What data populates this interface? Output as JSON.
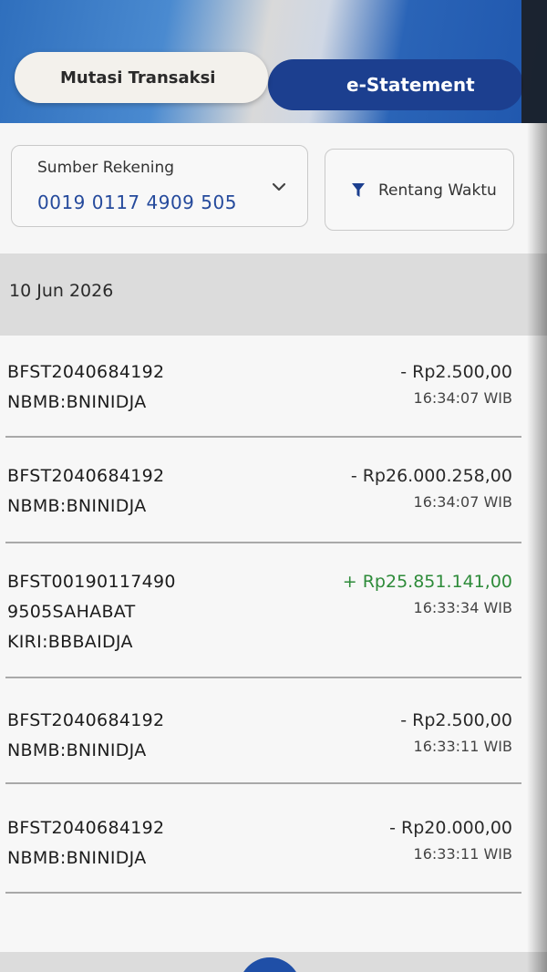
{
  "tabs": {
    "mutasi_label": "Mutasi Transaksi",
    "statement_label": "e-Statement"
  },
  "filters": {
    "account_label": "Sumber Rekening",
    "account_number": "0019 0117 4909 505",
    "range_label": "Rentang Waktu"
  },
  "date_header": "10 Jun 2026",
  "transactions": [
    {
      "desc_line1": "BFST2040684192",
      "desc_line2": "NBMB:BNINIDJA",
      "desc_line3": "",
      "amount": "- Rp2.500,00",
      "time": "16:34:07 WIB",
      "type": "debit"
    },
    {
      "desc_line1": "BFST2040684192",
      "desc_line2": "NBMB:BNINIDJA",
      "desc_line3": "",
      "amount": "- Rp26.000.258,00",
      "time": "16:34:07 WIB",
      "type": "debit"
    },
    {
      "desc_line1": "BFST00190117490",
      "desc_line2": "9505SAHABAT",
      "desc_line3": "KIRI:BBBAIDJA",
      "amount": "+ Rp25.851.141,00",
      "time": "16:33:34 WIB",
      "type": "credit"
    },
    {
      "desc_line1": "BFST2040684192",
      "desc_line2": "NBMB:BNINIDJA",
      "desc_line3": "",
      "amount": "- Rp2.500,00",
      "time": "16:33:11 WIB",
      "type": "debit"
    },
    {
      "desc_line1": "BFST2040684192",
      "desc_line2": "NBMB:BNINIDJA",
      "desc_line3": "",
      "amount": "- Rp20.000,00",
      "time": "16:33:11 WIB",
      "type": "debit"
    }
  ],
  "colors": {
    "accent": "#1c3f8f",
    "credit": "#2e8b3a",
    "account_number": "#254a9c"
  }
}
